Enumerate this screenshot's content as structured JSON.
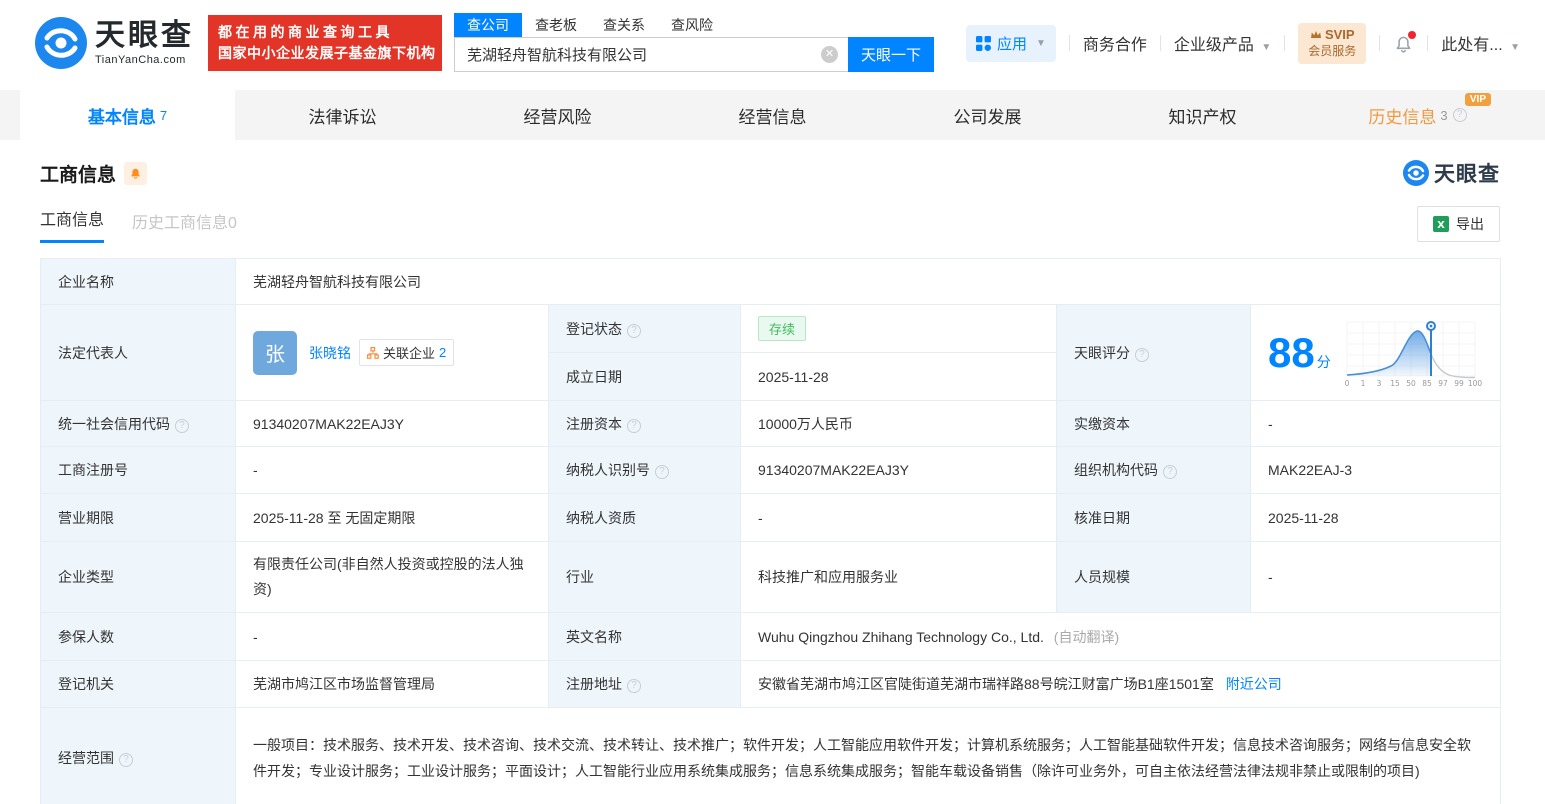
{
  "header": {
    "logo": {
      "name": "天眼查",
      "domain": "TianYanCha.com"
    },
    "banner": {
      "line1": "都在用的商业查询工具",
      "line2": "国家中小企业发展子基金旗下机构"
    },
    "search": {
      "tabs": [
        {
          "label": "查公司"
        },
        {
          "label": "查老板"
        },
        {
          "label": "查关系"
        },
        {
          "label": "查风险"
        }
      ],
      "value": "芜湖轻舟智航科技有限公司",
      "button": "天眼一下"
    },
    "nav": {
      "apps": "应用",
      "cooperation": "商务合作",
      "enterprise": "企业级产品",
      "svip_top": "SVIP",
      "svip_bottom": "会员服务",
      "user": "此处有..."
    }
  },
  "tabs": [
    {
      "label": "基本信息",
      "count": "7"
    },
    {
      "label": "法律诉讼"
    },
    {
      "label": "经营风险"
    },
    {
      "label": "经营信息"
    },
    {
      "label": "公司发展"
    },
    {
      "label": "知识产权"
    },
    {
      "label": "历史信息",
      "count": "3",
      "badge": "VIP"
    }
  ],
  "section": {
    "title": "工商信息",
    "logo_text": "天眼查",
    "sub_tabs": [
      {
        "label": "工商信息"
      },
      {
        "label": "历史工商信息0"
      }
    ],
    "export_label": "导出"
  },
  "fields": {
    "company_name": {
      "label": "企业名称",
      "value": "芜湖轻舟智航科技有限公司"
    },
    "legal_rep": {
      "label": "法定代表人",
      "avatar": "张",
      "name": "张晓铭",
      "related_label": "关联企业",
      "related_count": "2"
    },
    "reg_status": {
      "label": "登记状态",
      "value": "存续"
    },
    "establish_date": {
      "label": "成立日期",
      "value": "2025-11-28"
    },
    "tyc_score": {
      "label": "天眼评分",
      "score": "88",
      "unit": "分",
      "ticks": [
        "0",
        "1",
        "3",
        "15",
        "50",
        "85",
        "97",
        "99",
        "100"
      ]
    },
    "credit_code": {
      "label": "统一社会信用代码",
      "value": "91340207MAK22EAJ3Y"
    },
    "reg_capital": {
      "label": "注册资本",
      "value": "10000万人民币"
    },
    "paid_capital": {
      "label": "实缴资本",
      "value": "-"
    },
    "reg_number": {
      "label": "工商注册号",
      "value": "-"
    },
    "taxpayer_id": {
      "label": "纳税人识别号",
      "value": "91340207MAK22EAJ3Y"
    },
    "org_code": {
      "label": "组织机构代码",
      "value": "MAK22EAJ-3"
    },
    "business_term": {
      "label": "营业期限",
      "value": "2025-11-28 至 无固定期限"
    },
    "taxpayer_quality": {
      "label": "纳税人资质",
      "value": "-"
    },
    "approval_date": {
      "label": "核准日期",
      "value": "2025-11-28"
    },
    "company_type": {
      "label": "企业类型",
      "value": "有限责任公司(非自然人投资或控股的法人独资)"
    },
    "industry": {
      "label": "行业",
      "value": "科技推广和应用服务业"
    },
    "staff_size": {
      "label": "人员规模",
      "value": "-"
    },
    "insured_count": {
      "label": "参保人数",
      "value": "-"
    },
    "english_name": {
      "label": "英文名称",
      "value": "Wuhu Qingzhou Zhihang Technology Co., Ltd.",
      "note": "(自动翻译)"
    },
    "reg_authority": {
      "label": "登记机关",
      "value": "芜湖市鸠江区市场监督管理局"
    },
    "reg_address": {
      "label": "注册地址",
      "value": "安徽省芜湖市鸠江区官陡街道芜湖市瑞祥路88号皖江财富广场B1座1501室",
      "link": "附近公司"
    },
    "business_scope": {
      "label": "经营范围",
      "value": "一般项目：技术服务、技术开发、技术咨询、技术交流、技术转让、技术推广；软件开发；人工智能应用软件开发；计算机系统服务；人工智能基础软件开发；信息技术咨询服务；网络与信息安全软件开发；专业设计服务；工业设计服务；平面设计；人工智能行业应用系统集成服务；信息系统集成服务；智能车载设备销售（除许可业务外，可自主依法经营法律法规非禁止或限制的项目)"
    }
  },
  "colors": {
    "accent": "#0084ff",
    "banner_red": "#e23527",
    "orange": "#ff8c1f",
    "status_green": "#3dbd5b"
  }
}
